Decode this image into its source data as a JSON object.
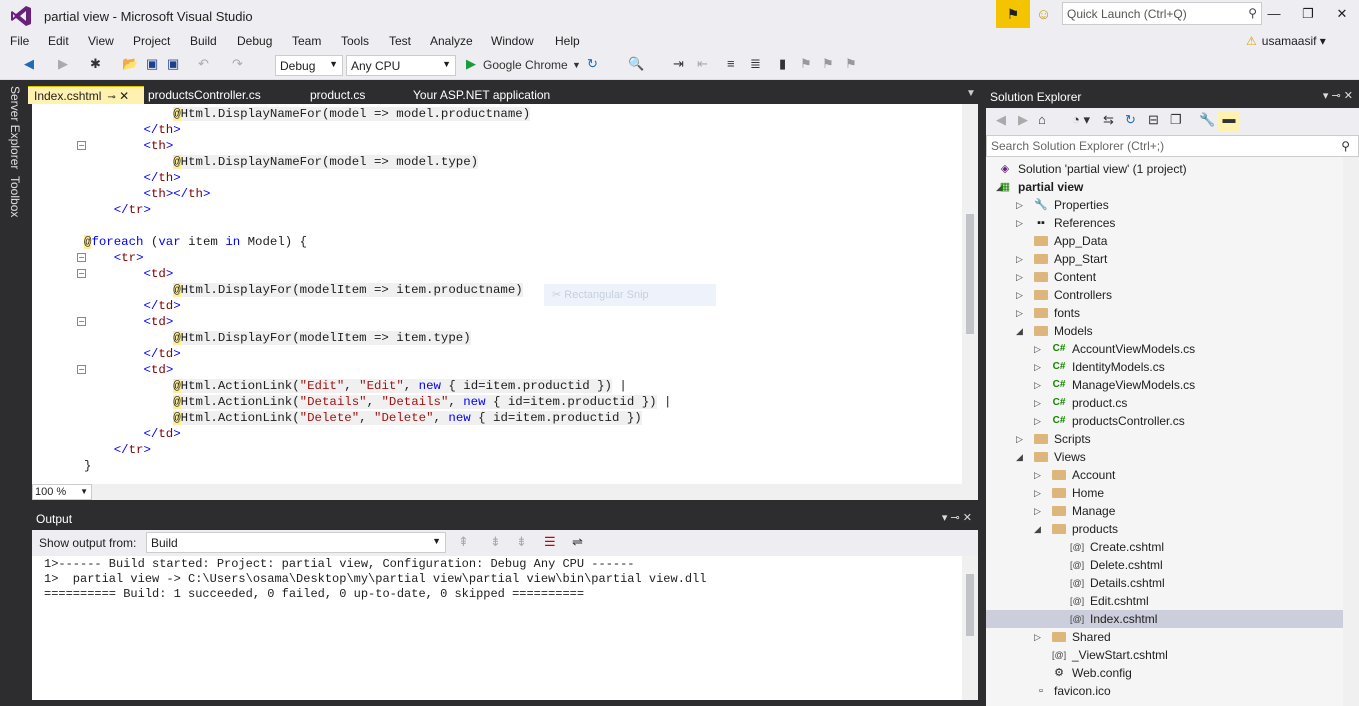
{
  "window": {
    "title": "partial view - Microsoft Visual Studio",
    "quick_launch_placeholder": "Quick Launch (Ctrl+Q)",
    "user": "usamaasif"
  },
  "menu": [
    "File",
    "Edit",
    "View",
    "Project",
    "Build",
    "Debug",
    "Team",
    "Tools",
    "Test",
    "Analyze",
    "Window",
    "Help"
  ],
  "toolbar": {
    "config": "Debug",
    "platform": "Any CPU",
    "run_target": "Google Chrome"
  },
  "side_tabs": [
    "Server Explorer",
    "Toolbox"
  ],
  "tabs": [
    {
      "label": "Index.cshtml",
      "active": true
    },
    {
      "label": "productsController.cs",
      "active": false
    },
    {
      "label": "product.cs",
      "active": false
    },
    {
      "label": "Your ASP.NET application",
      "active": false
    }
  ],
  "editor": {
    "zoom": "100 %",
    "snip_overlay": "Rectangular Snip"
  },
  "output": {
    "title": "Output",
    "show_output_from_label": "Show output from:",
    "source": "Build",
    "lines": [
      "1>------ Build started: Project: partial view, Configuration: Debug Any CPU ------",
      "1>  partial view -> C:\\Users\\osama\\Desktop\\my\\partial view\\partial view\\bin\\partial view.dll",
      "========== Build: 1 succeeded, 0 failed, 0 up-to-date, 0 skipped =========="
    ]
  },
  "solution_explorer": {
    "title": "Solution Explorer",
    "search_placeholder": "Search Solution Explorer (Ctrl+;)",
    "nodes": [
      {
        "label": "Solution 'partial view' (1 project)"
      },
      {
        "label": "partial view"
      },
      {
        "label": "Properties"
      },
      {
        "label": "References"
      },
      {
        "label": "App_Data"
      },
      {
        "label": "App_Start"
      },
      {
        "label": "Content"
      },
      {
        "label": "Controllers"
      },
      {
        "label": "fonts"
      },
      {
        "label": "Models"
      },
      {
        "label": "AccountViewModels.cs"
      },
      {
        "label": "IdentityModels.cs"
      },
      {
        "label": "ManageViewModels.cs"
      },
      {
        "label": "product.cs"
      },
      {
        "label": "productsController.cs"
      },
      {
        "label": "Scripts"
      },
      {
        "label": "Views"
      },
      {
        "label": "Account"
      },
      {
        "label": "Home"
      },
      {
        "label": "Manage"
      },
      {
        "label": "products"
      },
      {
        "label": "Create.cshtml"
      },
      {
        "label": "Delete.cshtml"
      },
      {
        "label": "Details.cshtml"
      },
      {
        "label": "Edit.cshtml"
      },
      {
        "label": "Index.cshtml"
      },
      {
        "label": "Shared"
      },
      {
        "label": "_ViewStart.cshtml"
      },
      {
        "label": "Web.config"
      },
      {
        "label": "favicon.ico"
      }
    ]
  }
}
